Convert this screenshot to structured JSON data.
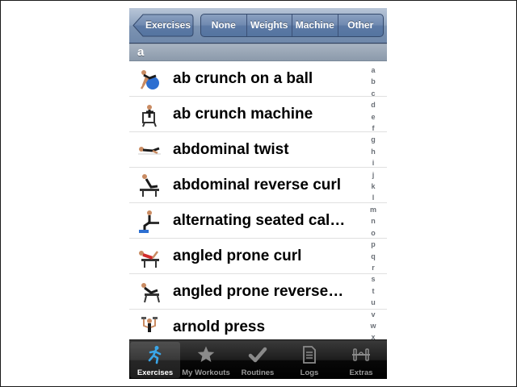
{
  "navbar": {
    "back_label": "Exercises",
    "filters": [
      "None",
      "Weights",
      "Machine",
      "Other"
    ]
  },
  "section": {
    "title": "a"
  },
  "exercises": [
    "ab crunch on a ball",
    "ab crunch machine",
    "abdominal twist",
    "abdominal reverse curl",
    "alternating seated cal…",
    "angled prone curl",
    "angled prone reverse…",
    "arnold press"
  ],
  "index_letters": [
    "a",
    "b",
    "c",
    "d",
    "e",
    "f",
    "g",
    "h",
    "i",
    "j",
    "k",
    "l",
    "m",
    "n",
    "o",
    "p",
    "q",
    "r",
    "s",
    "t",
    "u",
    "v",
    "w",
    "x",
    "y",
    "z"
  ],
  "tabbar": {
    "tabs": [
      {
        "label": "Exercises",
        "icon": "runner-icon",
        "selected": true
      },
      {
        "label": "My Workouts",
        "icon": "star-icon",
        "selected": false
      },
      {
        "label": "Routines",
        "icon": "checkmark-icon",
        "selected": false
      },
      {
        "label": "Logs",
        "icon": "document-icon",
        "selected": false
      },
      {
        "label": "Extras",
        "icon": "barbell-icon",
        "selected": false
      }
    ]
  },
  "colors": {
    "accent_blue": "#3aa6e8",
    "nav_blue": "#6f88aa",
    "tab_inactive": "#9a9a9a"
  }
}
